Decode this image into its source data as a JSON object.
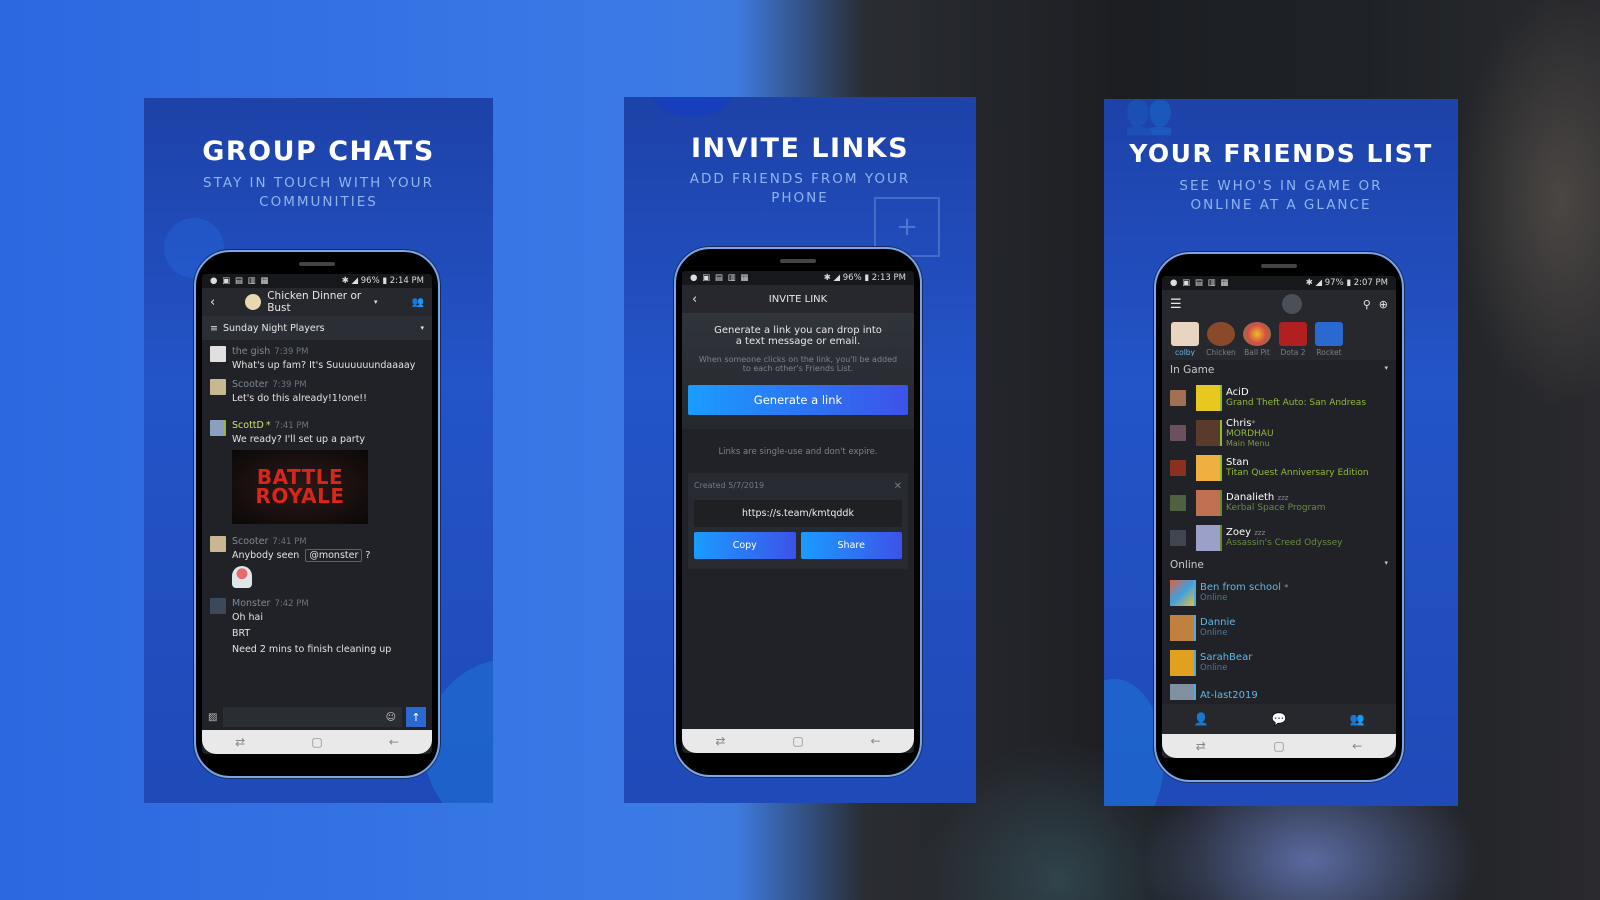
{
  "panels": [
    {
      "title": "GROUP CHATS",
      "subtitle": "STAY IN TOUCH WITH YOUR COMMUNITIES",
      "phone": {
        "status_time": "2:14 PM",
        "battery": "96%",
        "header": {
          "back_icon": "chevron-left-icon",
          "group_name": "Chicken Dinner or Bust",
          "members_icon": "members-icon"
        },
        "channel": {
          "name": "Sunday Night Players",
          "icon": "channel-list-icon"
        },
        "messages": [
          {
            "author": "the gish",
            "time": "7:39 PM",
            "lines": [
              "What's up fam? It's Suuuuuuundaaaay"
            ]
          },
          {
            "author": "Scooter",
            "time": "7:39 PM",
            "lines": [
              "Let's do this already!1!one!!"
            ]
          },
          {
            "author": "ScottD",
            "badge": "*",
            "time": "7:41 PM",
            "lines": [
              "We ready? I'll set up a party"
            ],
            "image_text": [
              "BATTLE",
              "ROYALE"
            ]
          },
          {
            "author": "Scooter",
            "time": "7:41 PM",
            "lines": [
              "Anybody seen"
            ],
            "mention": "@monster",
            "suffix": "?",
            "sticker": true
          },
          {
            "author": "Monster",
            "time": "7:42 PM",
            "lines": [
              "Oh hai",
              "BRT",
              "Need 2 mins to finish cleaning up"
            ]
          }
        ],
        "composer": {
          "image_icon": "image-icon",
          "emoji_icon": "emoji-icon",
          "send_icon": "send-arrow-icon"
        }
      }
    },
    {
      "title": "INVITE LINKS",
      "subtitle": "ADD FRIENDS FROM YOUR PHONE",
      "phone": {
        "status_time": "2:13 PM",
        "battery": "96%",
        "header_title": "INVITE LINK",
        "intro": "Generate a link you can drop into a text message or email.",
        "intro_note": "When someone clicks on the link, you'll be added to each other's Friends List.",
        "generate_label": "Generate a link",
        "note": "Links are single-use and don't expire.",
        "link_card": {
          "created": "Created 5/7/2019",
          "url": "https://s.team/kmtqddk",
          "copy_label": "Copy",
          "share_label": "Share"
        }
      }
    },
    {
      "title": "YOUR FRIENDS LIST",
      "subtitle": "SEE WHO'S IN GAME OR ONLINE AT A GLANCE",
      "phone": {
        "status_time": "2:07 PM",
        "battery": "97%",
        "favorites": [
          {
            "label": "colby",
            "color": "#e8d4c0"
          },
          {
            "label": "Chicken",
            "color": "#8a4a2a"
          },
          {
            "label": "Ball Pit",
            "color": "#d84a4a"
          },
          {
            "label": "Dota 2",
            "color": "#b02020"
          },
          {
            "label": "Rocket",
            "color": "#2a6ad0"
          }
        ],
        "in_game_label": "In Game",
        "in_game": [
          {
            "name": "AciD",
            "game": "Grand Theft Auto: San Andreas",
            "sub": "",
            "color": "#e8c820"
          },
          {
            "name": "Chris",
            "badge": "*",
            "game": "MORDHAU",
            "sub": "Main Menu",
            "color": "#5a3a2a"
          },
          {
            "name": "Stan",
            "game": "Titan Quest Anniversary Edition",
            "sub": "",
            "color": "#f0b040"
          },
          {
            "name": "Danalieth",
            "badge": "zzz",
            "game": "Kerbal Space Program",
            "sub": "",
            "color": "#c07050"
          },
          {
            "name": "Zoey",
            "badge": "zzz",
            "game": "Assassin's Creed Odyssey",
            "sub": "",
            "color": "#9aa0c8"
          }
        ],
        "online_label": "Online",
        "online": [
          {
            "name": "Ben from school",
            "badge": "*",
            "status": "Online",
            "color": "#e06040"
          },
          {
            "name": "Dannie",
            "status": "Online",
            "color": "#c08040"
          },
          {
            "name": "SarahBear",
            "status": "Online",
            "color": "#e0a020"
          },
          {
            "name": "At-last2019",
            "status": "",
            "color": "#8090a0"
          }
        ],
        "tabs": [
          "friends-tab",
          "chats-tab",
          "groups-tab"
        ]
      }
    }
  ]
}
